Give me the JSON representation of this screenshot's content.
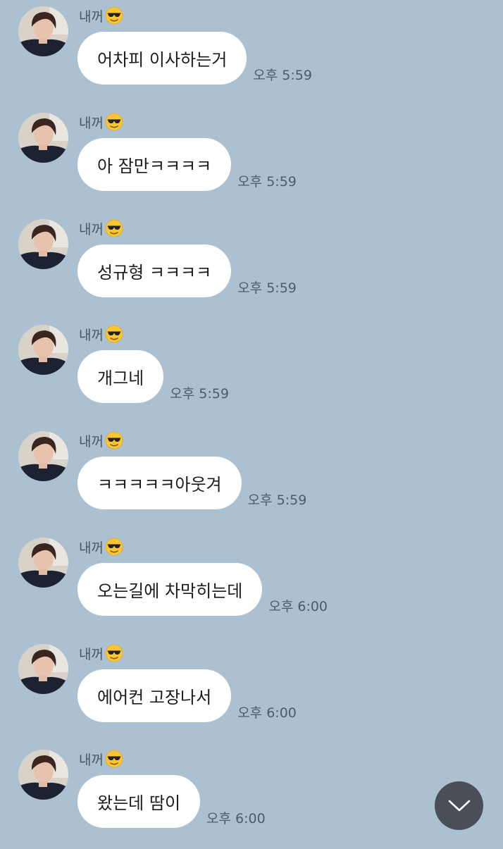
{
  "messages": [
    {
      "sender": "내꺼",
      "text": "어차피 이사하는거",
      "time": "오후 5:59"
    },
    {
      "sender": "내꺼",
      "text": "아 잠만ㅋㅋㅋㅋ",
      "time": "오후 5:59"
    },
    {
      "sender": "내꺼",
      "text": "성규형 ㅋㅋㅋㅋ",
      "time": "오후 5:59"
    },
    {
      "sender": "내꺼",
      "text": "개그네",
      "time": "오후 5:59"
    },
    {
      "sender": "내꺼",
      "text": "ㅋㅋㅋㅋㅋ아웃겨",
      "time": "오후 5:59"
    },
    {
      "sender": "내꺼",
      "text": "오는길에 차막히는데",
      "time": "오후 6:00"
    },
    {
      "sender": "내꺼",
      "text": "에어컨 고장나서",
      "time": "오후 6:00"
    },
    {
      "sender": "내꺼",
      "text": "왔는데 땀이",
      "time": "오후 6:00"
    }
  ],
  "sender_emoji": "sunglasses-emoji",
  "scroll_button": {
    "icon": "chevron-down-icon"
  },
  "colors": {
    "background": "#abc1d1",
    "bubble": "#ffffff",
    "scroll_button": "#4a4f57"
  }
}
